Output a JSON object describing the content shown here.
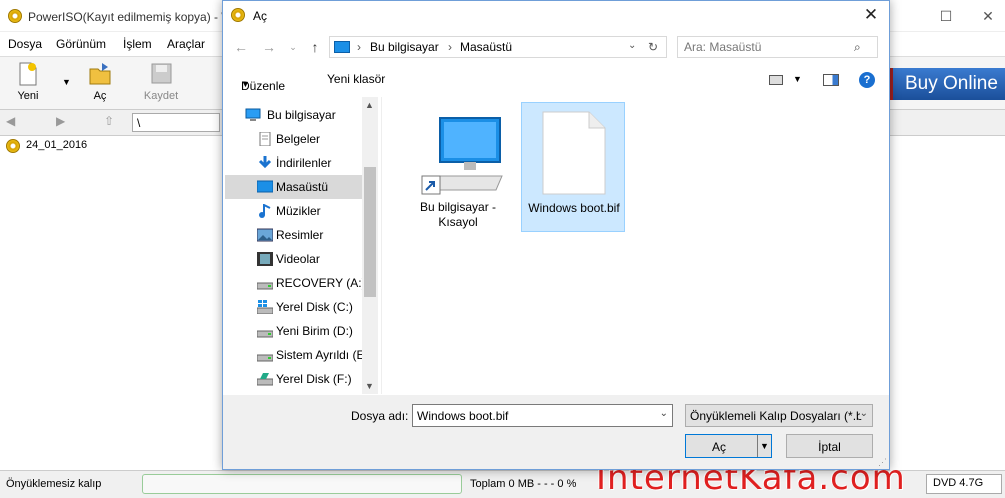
{
  "app": {
    "title": "PowerISO(Kayıt edilmemiş kopya) - \\",
    "menu": [
      "Dosya",
      "Görünüm",
      "İşlem",
      "Araçlar"
    ],
    "toolbar": {
      "new": "Yeni",
      "open": "Aç",
      "save": "Kaydet"
    },
    "buy_online": "Buy Online",
    "path": "\\",
    "tree_item": "24_01_2016",
    "status": {
      "left": "Önyüklemesiz kalıp",
      "total": "Toplam 0 MB  - - -  0 %",
      "media": "DVD 4.7G"
    },
    "watermark": "InternetKafa.com"
  },
  "dialog": {
    "title": "Aç",
    "breadcrumb": [
      "Bu bilgisayar",
      "Masaüstü"
    ],
    "search_placeholder": "Ara: Masaüstü",
    "organize": "Düzenle",
    "new_folder": "Yeni klasör",
    "nav": [
      {
        "label": "Bu bilgisayar",
        "icon": "computer-icon"
      },
      {
        "label": "Belgeler",
        "icon": "documents-icon"
      },
      {
        "label": "İndirilenler",
        "icon": "download-icon"
      },
      {
        "label": "Masaüstü",
        "icon": "desktop-icon",
        "selected": true
      },
      {
        "label": "Müzikler",
        "icon": "music-icon"
      },
      {
        "label": "Resimler",
        "icon": "pictures-icon"
      },
      {
        "label": "Videolar",
        "icon": "videos-icon"
      },
      {
        "label": "RECOVERY (A:)",
        "icon": "drive-icon"
      },
      {
        "label": "Yerel Disk (C:)",
        "icon": "windows-drive-icon"
      },
      {
        "label": "Yeni Birim (D:)",
        "icon": "drive-icon"
      },
      {
        "label": "Sistem Ayrıldı (E:",
        "icon": "drive-icon"
      },
      {
        "label": "Yerel Disk (F:)",
        "icon": "drive-icon"
      }
    ],
    "files": [
      {
        "label": "Bu bilgisayar - Kısayol",
        "icon": "computer-shortcut-icon"
      },
      {
        "label": "Windows boot.bif",
        "icon": "file-icon",
        "selected": true
      }
    ],
    "filename_label": "Dosya adı:",
    "filename_value": "Windows boot.bif",
    "filetype": "Önyüklemeli Kalıp Dosyaları (*.b",
    "open": "Aç",
    "cancel": "İptal"
  }
}
